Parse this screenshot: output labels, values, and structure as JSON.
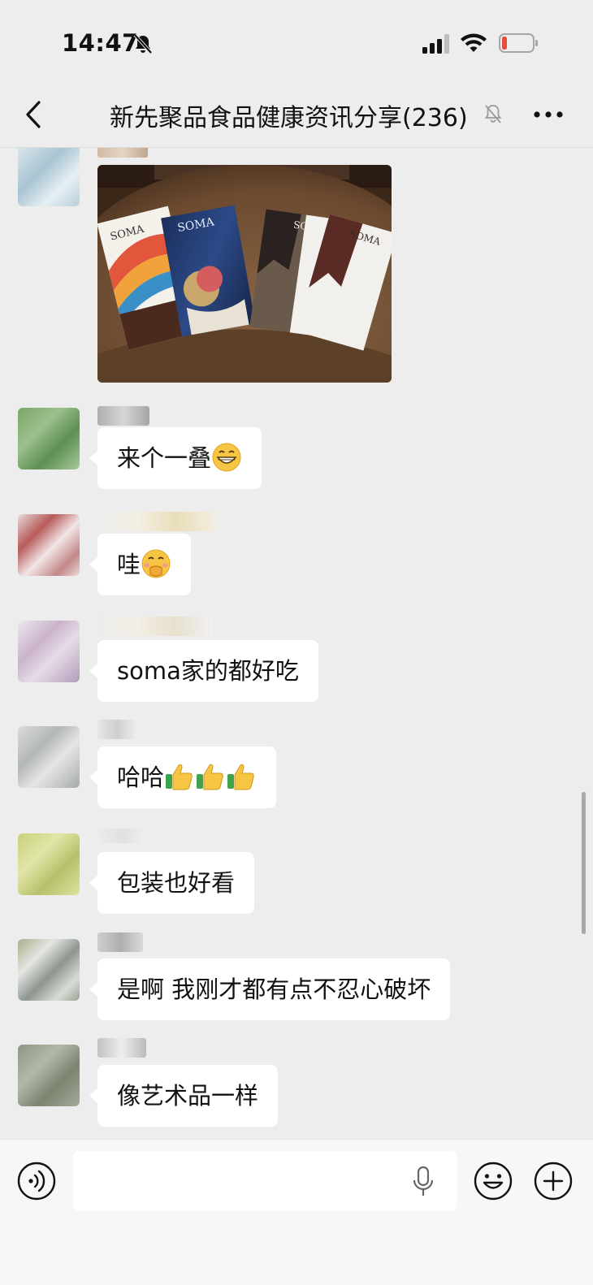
{
  "status": {
    "time": "14:47"
  },
  "header": {
    "title": "新先聚品食品健康资讯分享(236)"
  },
  "messages": [
    {
      "type": "image",
      "alt": "SOMA"
    },
    {
      "type": "text",
      "text": "来个一叠",
      "emoji": "grin"
    },
    {
      "type": "text",
      "text": "哇",
      "emoji": "peek"
    },
    {
      "type": "text",
      "text": "soma家的都好吃"
    },
    {
      "type": "text",
      "text": "哈哈",
      "emoji": "thumbs-up-x3"
    },
    {
      "type": "text",
      "text": "包装也好看"
    },
    {
      "type": "text",
      "text": "是啊 我刚才都有点不忍心破坏"
    },
    {
      "type": "text",
      "text": "像艺术品一样"
    }
  ],
  "input": {
    "value": "",
    "placeholder": ""
  },
  "colors": {
    "background": "#ededed",
    "bubble": "#ffffff",
    "battery_low": "#e74c3c"
  }
}
